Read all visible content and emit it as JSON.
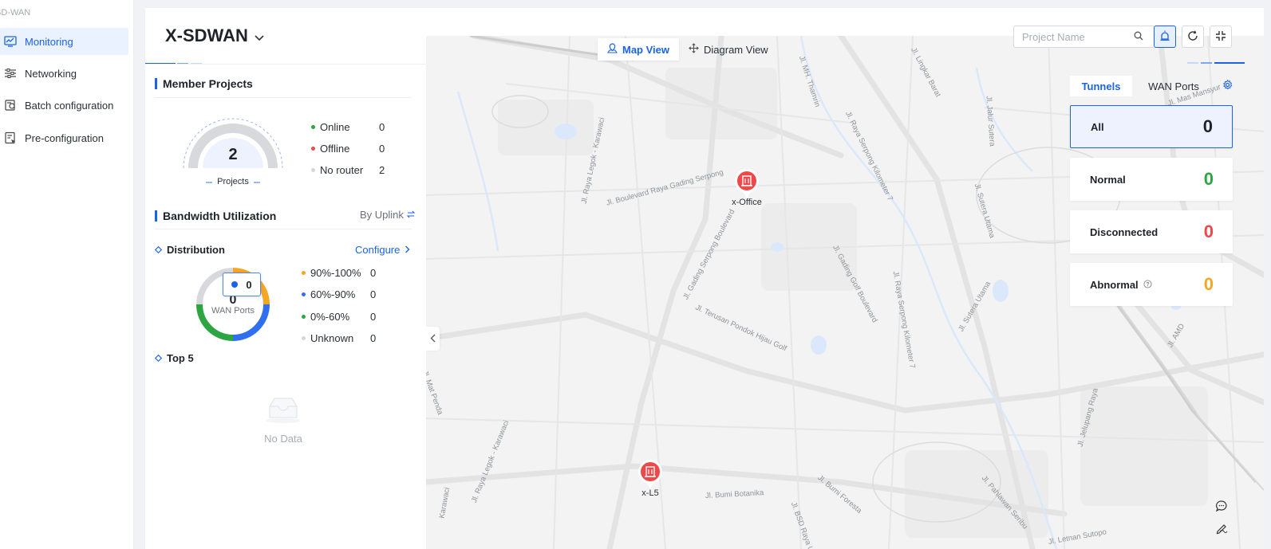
{
  "sidebar": {
    "app_name": "SD-WAN",
    "items": [
      {
        "label": "Monitoring",
        "icon": "chart-monitor-icon",
        "active": true
      },
      {
        "label": "Networking",
        "icon": "sliders-icon",
        "active": false
      },
      {
        "label": "Batch configuration",
        "icon": "batch-config-icon",
        "active": false
      },
      {
        "label": "Pre-configuration",
        "icon": "pre-config-icon",
        "active": false
      }
    ]
  },
  "header": {
    "project_title": "X-SDWAN",
    "search_placeholder": "Project Name",
    "search_value": ""
  },
  "view_toggle": {
    "map_view_label": "Map View",
    "diagram_view_label": "Diagram View",
    "active": "map"
  },
  "member_projects": {
    "title": "Member Projects",
    "total": "2",
    "total_label": "Projects",
    "legend": [
      {
        "label": "Online",
        "value": "0",
        "color": "#2da641"
      },
      {
        "label": "Offline",
        "value": "0",
        "color": "#f04848"
      },
      {
        "label": "No router",
        "value": "2",
        "color": "#d3d6db"
      }
    ]
  },
  "bandwidth": {
    "title": "Bandwidth Utilization",
    "by_uplink_label": "By Uplink",
    "distribution_label": "Distribution",
    "configure_label": "Configure",
    "donut_total": "0",
    "donut_label": "WAN Ports",
    "tooltip_value": "0",
    "legend": [
      {
        "label": "90%-100%",
        "value": "0",
        "color": "#f5a623"
      },
      {
        "label": "60%-90%",
        "value": "0",
        "color": "#2f6ff0"
      },
      {
        "label": "0%-60%",
        "value": "0",
        "color": "#2da641"
      },
      {
        "label": "Unknown",
        "value": "0",
        "color": "#d3d6db"
      }
    ],
    "top5_label": "Top 5",
    "no_data_label": "No Data"
  },
  "map": {
    "markers": [
      {
        "label": "x-Office"
      },
      {
        "label": "x-L5"
      }
    ],
    "road_labels": [
      "Jl. MH. Thamrin",
      "Jl. Lingkar Barat",
      "Jl. Jalur Sutera",
      "Jl. Raya Legok - Karawaci",
      "Jl. Boulevard Raya Gading Serpong",
      "Jl. Raya Serpong Kilometer 7",
      "Jl. Sutera Utama",
      "Jl. Gading Serpong Boulevard",
      "Jl. Gading Golf Boulevard",
      "Jl. Terusan Pondok Hijau Golf",
      "Jl. Raya Serpong Kilometer 7",
      "Jl. Sutera Utama",
      "Jl. AMD",
      "Jl. Mas Mansyur",
      "Jl. Raya Legok - Karawaci",
      "Jl. Jelupang Raya",
      "Jl. Bumi Botanika",
      "Jl. BSD Raya Utama",
      "Jl. Bumi Foresta",
      "Jl. Pahlawan Seribu",
      "Jl. Letnan Sutopo",
      "Jl. Mat Penda",
      "Karawaci"
    ]
  },
  "tunnels": {
    "tab_tunnels": "Tunnels",
    "tab_wan_ports": "WAN Ports",
    "cards": [
      {
        "label": "All",
        "value": "0",
        "color": "#1f2329"
      },
      {
        "label": "Normal",
        "value": "0",
        "color": "#2da641"
      },
      {
        "label": "Disconnected",
        "value": "0",
        "color": "#f04848"
      },
      {
        "label": "Abnormal",
        "value": "0",
        "color": "#f5a623"
      }
    ]
  }
}
